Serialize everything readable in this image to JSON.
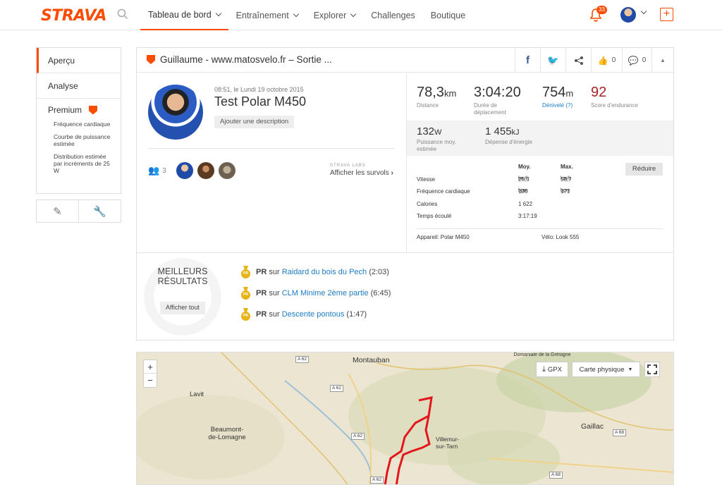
{
  "header": {
    "logo": "STRAVA",
    "nav": [
      {
        "label": "Tableau de bord",
        "active": true,
        "dropdown": true
      },
      {
        "label": "Entraînement",
        "dropdown": true
      },
      {
        "label": "Explorer",
        "dropdown": true
      },
      {
        "label": "Challenges"
      },
      {
        "label": "Boutique"
      }
    ],
    "notification_count": "33",
    "accent_color": "#fc4c02"
  },
  "sidebar": {
    "items": [
      {
        "label": "Aperçu"
      },
      {
        "label": "Analyse"
      },
      {
        "label": "Premium"
      }
    ],
    "sub_items": [
      "Fréquence cardiaque",
      "Courbe de puissance estimée",
      "Distribution estimée par incréments de 25 W"
    ]
  },
  "activity": {
    "heading": "Guillaume - www.matosvelo.fr – Sortie ...",
    "kudos_count": "0",
    "comments_count": "0",
    "date": "08:51, le Lundi 19 octobre 2015",
    "title": "Test Polar M450",
    "add_description": "Ajouter une description",
    "athletes_count": "3",
    "labs_label": "STRAVA LABS",
    "flyby_label": "Afficher les survols",
    "stats": [
      {
        "value": "78,3",
        "unit": "km",
        "label": "Distance"
      },
      {
        "value": "3:04:20",
        "unit": "",
        "label": "Durée de déplacement"
      },
      {
        "value": "754",
        "unit": "m",
        "label": "Dénivelé (?)"
      },
      {
        "value": "92",
        "unit": "",
        "label": "Score d'endurance"
      }
    ],
    "secondary_stats": [
      {
        "value": "132",
        "unit": "W",
        "label": "Puissance moy. estimée"
      },
      {
        "value": "1 455",
        "unit": "kJ",
        "label": "Dépense d'énergie"
      }
    ],
    "table": {
      "col_avg": "Moy.",
      "col_max": "Max.",
      "reduce_label": "Réduire",
      "rows": [
        {
          "label": "Vitesse",
          "avg": "25,5",
          "avg_unit": "km/h",
          "max": "58,7",
          "max_unit": "km/h"
        },
        {
          "label": "Fréquence cardiaque",
          "avg": "136",
          "avg_unit": "bpm",
          "max": "171",
          "max_unit": "bpm"
        },
        {
          "label": "Calories",
          "avg": "1 622",
          "avg_unit": "",
          "max": "",
          "max_unit": ""
        },
        {
          "label": "Temps écoulé",
          "avg": "3:17:19",
          "avg_unit": "",
          "max": "",
          "max_unit": ""
        }
      ],
      "device": "Appareil: Polar M450",
      "bike": "Vélo: Look 555"
    },
    "best_results": {
      "title_line1": "MEILLEURS",
      "title_line2": "RÉSULTATS",
      "button": "Afficher tout",
      "pr_label": "PR",
      "sur": "sur",
      "items": [
        {
          "segment": "Raidard du bois du Pech",
          "time": "(2:03)"
        },
        {
          "segment": "CLM Minime 2ème partie",
          "time": "(6:45)"
        },
        {
          "segment": "Descente pontous",
          "time": "(1:47)"
        }
      ]
    }
  },
  "map": {
    "gpx_label": "GPX",
    "map_type": "Carte physique",
    "zoom_in": "+",
    "zoom_out": "−",
    "places": [
      "Montauban",
      "Lavit",
      "Beaumont-de-Lomagne",
      "Villemur-sur-Tarn",
      "Gaillac",
      "Domaniale de la Grésigne"
    ],
    "roads": [
      "A 62",
      "A 62",
      "A 62",
      "A 62",
      "A 68",
      "A 68"
    ],
    "route_color": "#e3161b"
  }
}
